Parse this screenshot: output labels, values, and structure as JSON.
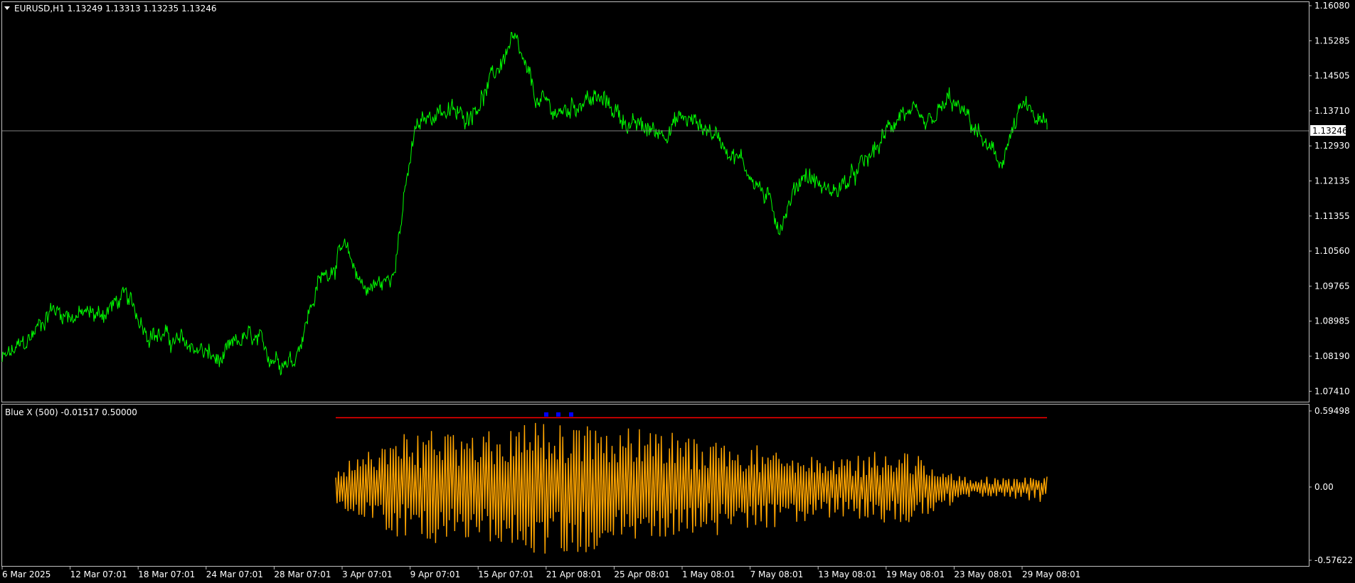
{
  "colors": {
    "background": "#000000",
    "frame": "#C0C0C0",
    "price_line": "#00FF00",
    "indicator_line": "#FFA500",
    "level_line": "#FF0000",
    "signal_marker": "#0000FF",
    "bid_line": "#808080",
    "bid_label_bg": "#FFFFFF",
    "bid_label_text": "#000000",
    "text": "#FFFFFF"
  },
  "main_panel": {
    "menu_icon": "triangle-down-icon",
    "header": "EURUSD,H1  1.13249 1.13313 1.13235 1.13246",
    "current_price_label": "1.13246",
    "price_labels": [
      "1.16080",
      "1.15285",
      "1.14505",
      "1.13710",
      "1.12930",
      "1.12135",
      "1.11355",
      "1.10560",
      "1.09765",
      "1.08985",
      "1.08190",
      "1.07410"
    ]
  },
  "indicator_panel": {
    "header": "Blue X (500) -0.01517 0.50000",
    "value_labels": [
      "0.59498",
      "0.00",
      "-0.57622"
    ]
  },
  "time_axis": {
    "labels": [
      "6 Mar 2025",
      "12 Mar 07:01",
      "18 Mar 07:01",
      "24 Mar 07:01",
      "28 Mar 07:01",
      "3 Apr 07:01",
      "9 Apr 07:01",
      "15 Apr 07:01",
      "21 Apr 08:01",
      "25 Apr 08:01",
      "1 May 08:01",
      "7 May 08:01",
      "13 May 08:01",
      "19 May 08:01",
      "23 May 08:01",
      "29 May 08:01"
    ]
  },
  "chart_data": [
    {
      "type": "line",
      "symbol": "EURUSD",
      "timeframe": "H1",
      "ohlc_last": {
        "open": 1.13249,
        "high": 1.13313,
        "low": 1.13235,
        "close": 1.13246
      },
      "current_price": 1.13246,
      "ylim": [
        1.0705,
        1.1613
      ],
      "x": [
        "6 Mar 2025",
        "12 Mar 07:01",
        "18 Mar 07:01",
        "24 Mar 07:01",
        "28 Mar 07:01",
        "3 Apr 07:01",
        "9 Apr 07:01",
        "15 Apr 07:01",
        "21 Apr 08:01",
        "25 Apr 08:01",
        "1 May 08:01",
        "7 May 08:01",
        "13 May 08:01",
        "19 May 08:01",
        "23 May 08:01",
        "29 May 08:01"
      ],
      "series": [
        {
          "values": [
            1.0795,
            1.0835,
            1.0915,
            1.09,
            1.09,
            1.094,
            1.087,
            1.084,
            1.0825,
            1.079,
            1.085,
            1.081,
            1.08,
            1.097,
            1.105,
            1.096,
            1.098,
            1.132,
            1.1375,
            1.135,
            1.142,
            1.153,
            1.139,
            1.136,
            1.14,
            1.138,
            1.133,
            1.132,
            1.135,
            1.133,
            1.128,
            1.121,
            1.111,
            1.123,
            1.118,
            1.121,
            1.128,
            1.137,
            1.132,
            1.139,
            1.133,
            1.124,
            1.1375,
            1.1325
          ]
        }
      ]
    },
    {
      "type": "line",
      "name": "Blue X (500)",
      "values_last": [
        -0.01517,
        0.5
      ],
      "ylim": [
        -0.63,
        0.66
      ],
      "series": [
        {
          "name": "level",
          "values": [
            0.5
          ]
        }
      ],
      "oscillation_envelope": [
        {
          "x": "3 Apr 07:01",
          "amp": 0.18
        },
        {
          "x": "9 Apr 07:01",
          "amp": 0.45
        },
        {
          "x": "15 Apr 07:01",
          "amp": 0.45
        },
        {
          "x": "21 Apr 08:01",
          "amp": 0.56
        },
        {
          "x": "25 Apr 08:01",
          "amp": 0.52
        },
        {
          "x": "1 May 08:01",
          "amp": 0.4
        },
        {
          "x": "7 May 08:01",
          "amp": 0.35
        },
        {
          "x": "13 May 08:01",
          "amp": 0.25
        },
        {
          "x": "19 May 08:01",
          "amp": 0.3
        },
        {
          "x": "23 May 08:01",
          "amp": 0.07
        },
        {
          "x": "29 May 08:01",
          "amp": 0.1
        }
      ],
      "signal_markers": 3
    }
  ]
}
